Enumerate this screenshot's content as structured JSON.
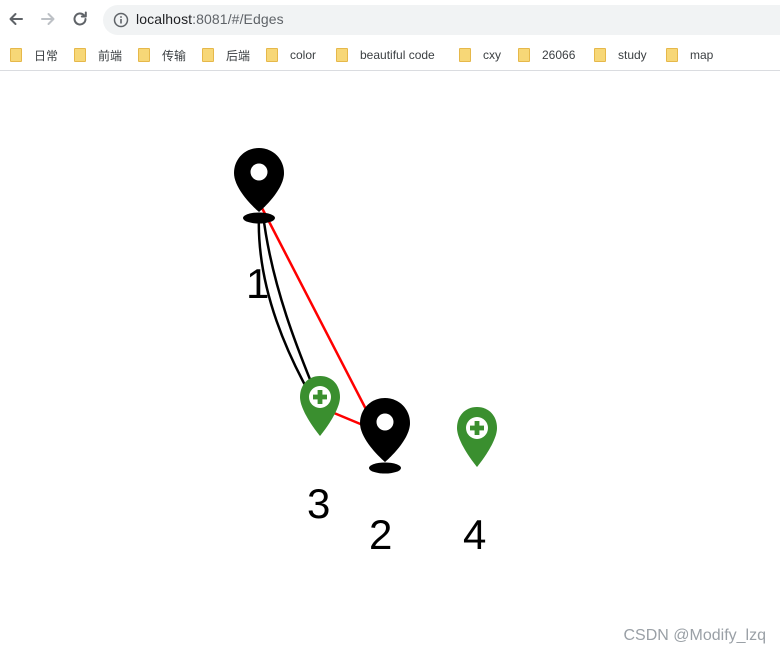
{
  "browser": {
    "url_host": "localhost",
    "url_rest": ":8081/#/Edges",
    "bookmarks": [
      {
        "label": "日常"
      },
      {
        "label": "前端"
      },
      {
        "label": "传输"
      },
      {
        "label": "后端"
      },
      {
        "label": "color"
      },
      {
        "label": "beautiful code"
      },
      {
        "label": "cxy"
      },
      {
        "label": "26066"
      },
      {
        "label": "study"
      },
      {
        "label": "map"
      }
    ]
  },
  "graph": {
    "nodes": [
      {
        "label": "1",
        "icon": "black-location-pin-icon",
        "color": "#000000"
      },
      {
        "label": "2",
        "icon": "black-location-pin-icon",
        "color": "#000000"
      },
      {
        "label": "3",
        "icon": "green-add-location-icon",
        "color": "#3a8f2f"
      },
      {
        "label": "4",
        "icon": "green-add-location-icon",
        "color": "#3a8f2f"
      }
    ],
    "edges": [
      {
        "from": "1",
        "to": "3",
        "color": "#000000",
        "arrow": true
      },
      {
        "from": "1",
        "to": "3",
        "color": "#000000",
        "arrow": true
      },
      {
        "from": "1",
        "to": "2",
        "color": "#ff0000",
        "arrow": false
      },
      {
        "from": "3",
        "to": "2",
        "color": "#ff0000",
        "arrow": false
      }
    ]
  },
  "watermark": "CSDN @Modify_lzq"
}
